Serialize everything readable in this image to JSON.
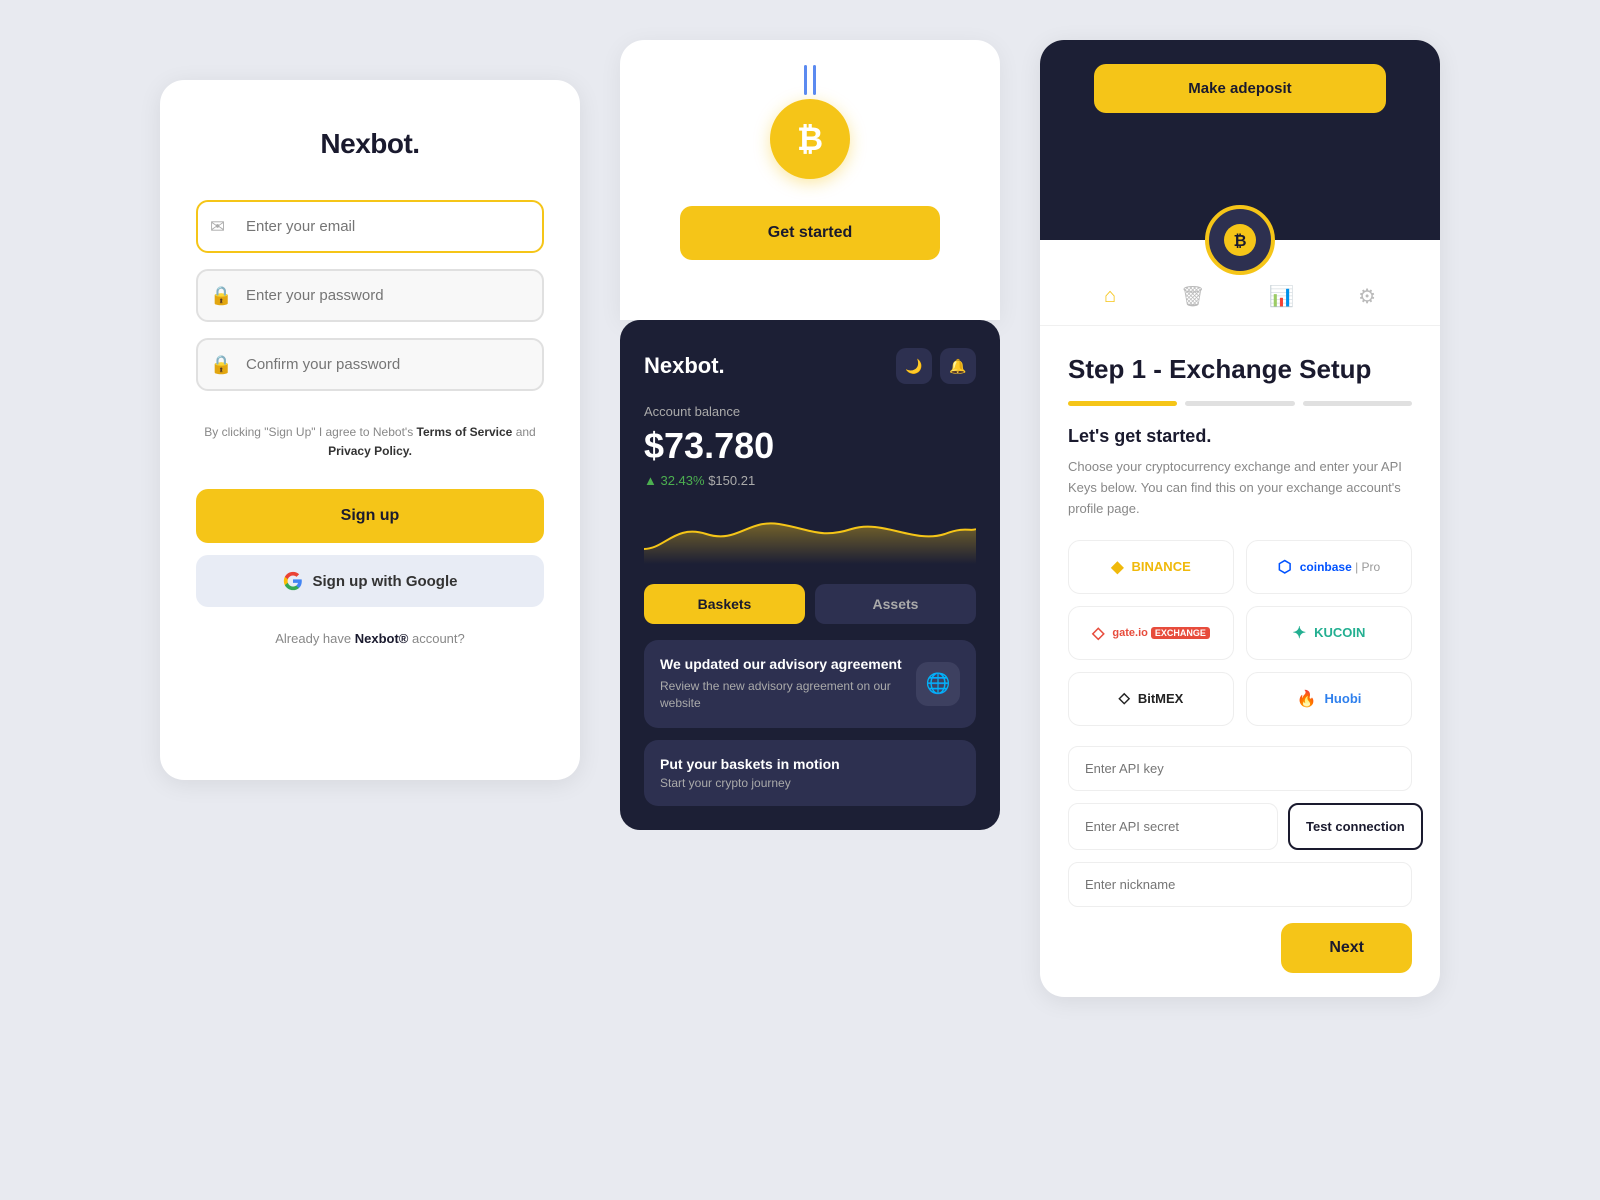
{
  "panel1": {
    "brand": "Nexbot.",
    "email_placeholder": "Enter your email",
    "password_placeholder": "Enter your password",
    "confirm_placeholder": "Confirm your password",
    "terms_prefix": "By clicking \"Sign Up\" I agree to Nebot's ",
    "terms_link1": "Terms of Service",
    "terms_and": " and ",
    "terms_link2": "Privacy Policy.",
    "signup_btn": "Sign up",
    "google_btn": "Sign up with Google",
    "already_prefix": "Already have ",
    "already_brand": "Nexbot®",
    "already_suffix": " account?"
  },
  "panel2": {
    "get_started": "Get started",
    "brand": "Nexbot.",
    "balance_label": "Account balance",
    "balance_amount": "$73.780",
    "balance_pct": "32.43%",
    "balance_usd": "$150.21",
    "tab_baskets": "Baskets",
    "tab_assets": "Assets",
    "advisory_title": "We updated our advisory agreement",
    "advisory_body": "Review the new advisory agreement on our website",
    "baskets_title": "Put your baskets in motion",
    "baskets_body": "Start your crypto journey"
  },
  "panel3": {
    "deposit_btn": "Make adeposit",
    "step_title": "Step 1 - Exchange Setup",
    "lets_started": "Let's get started.",
    "step_desc": "Choose your cryptocurrency exchange and enter your API Keys below. You can find this on your exchange account's profile page.",
    "exchanges": [
      {
        "name": "BINANCE",
        "color": "binance"
      },
      {
        "name": "coinbase | Pro",
        "color": "coinbase"
      },
      {
        "name": "gate.io EXCHANGE",
        "color": "gate"
      },
      {
        "name": "KUCOIN",
        "color": "kucoin"
      },
      {
        "name": "BitMEX",
        "color": "bitmex"
      },
      {
        "name": "Huobi",
        "color": "huobi"
      }
    ],
    "api_key_placeholder": "Enter API key",
    "api_secret_placeholder": "Enter API secret",
    "nickname_placeholder": "Enter nickname",
    "test_btn": "Test connection",
    "next_btn": "Next"
  },
  "icons": {
    "email": "✉",
    "lock": "🔒",
    "google": "G",
    "moon": "🌙",
    "bell": "🔔",
    "coin": "🪙",
    "home": "⌂",
    "trash": "🗑",
    "chart": "📊",
    "gear": "⚙"
  }
}
